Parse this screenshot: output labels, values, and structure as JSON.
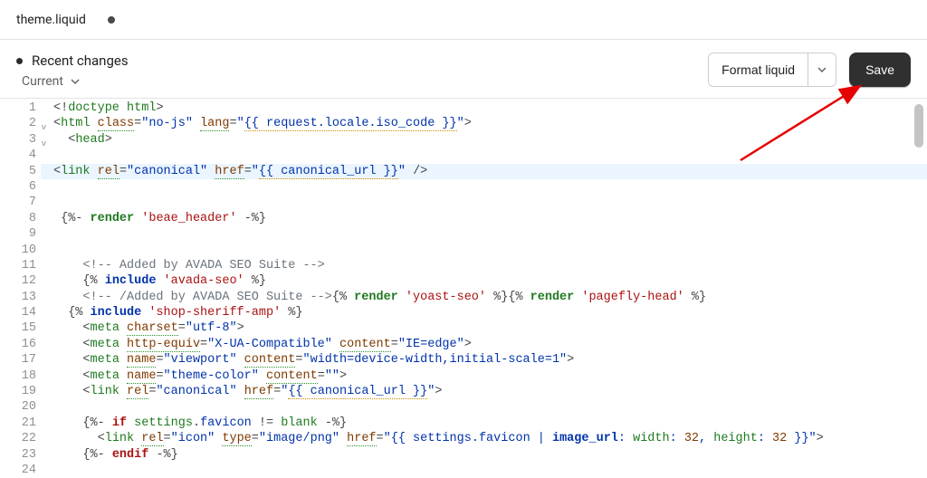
{
  "tab": {
    "filename": "theme.liquid"
  },
  "toolbar": {
    "recent_label": "Recent changes",
    "current_label": "Current",
    "format_label": "Format liquid",
    "save_label": "Save"
  },
  "editor": {
    "highlighted_line": 5,
    "lines": [
      {
        "no": 1,
        "fold": "",
        "html": "<span class='punc'>&lt;!</span><span class='tag'>doctype</span> <span class='tag'>html</span><span class='punc'>&gt;</span>"
      },
      {
        "no": 2,
        "fold": "v",
        "html": "<span class='punc'>&lt;</span><span class='tag'>html</span> <span class='attr underline-green'>class</span><span class='punc'>=</span><span class='str'>\"no-js\"</span> <span class='attr underline-green'>lang</span><span class='punc'>=</span><span class='str'>\"</span><span class='str underline-orange'>{{ request.locale.iso_code }}</span><span class='str'>\"</span><span class='punc'>&gt;</span>"
      },
      {
        "no": 3,
        "fold": "v",
        "html": "  <span class='punc'>&lt;</span><span class='tag'>head</span><span class='punc'>&gt;</span>"
      },
      {
        "no": 4,
        "fold": "",
        "html": ""
      },
      {
        "no": 5,
        "fold": "",
        "html": "<span class='punc'>&lt;</span><span class='tag'>link</span> <span class='attr underline-green'>rel</span><span class='punc'>=</span><span class='str'>\"canonical\"</span> <span class='attr underline-green'>href</span><span class='punc'>=</span><span class='str'>\"</span><span class='str underline-orange'>{{ canonical_url }}</span><span class='str'>\"</span> <span class='punc'>/&gt;</span>"
      },
      {
        "no": 6,
        "fold": "",
        "html": ""
      },
      {
        "no": 7,
        "fold": "",
        "html": ""
      },
      {
        "no": 8,
        "fold": "",
        "html": " <span class='punc'>{%-</span> <span class='liquid-tag'>render</span> <span class='single-str'>'beae_header'</span> <span class='punc'>-%}</span>"
      },
      {
        "no": 9,
        "fold": "",
        "html": ""
      },
      {
        "no": 10,
        "fold": "",
        "html": ""
      },
      {
        "no": 11,
        "fold": "",
        "html": "    <span class='comment'>&lt;!-- Added by AVADA SEO Suite --&gt;</span>"
      },
      {
        "no": 12,
        "fold": "",
        "html": "    <span class='punc'>{%</span> <span class='kw'>include</span> <span class='single-str'>'avada-seo'</span> <span class='punc'>%}</span>"
      },
      {
        "no": 13,
        "fold": "",
        "html": "    <span class='comment'>&lt;!-- /Added by AVADA SEO Suite --&gt;</span><span class='punc'>{%</span> <span class='liquid-tag'>render</span> <span class='single-str'>'yoast-seo'</span> <span class='punc'>%}</span><span class='punc'>{%</span> <span class='liquid-tag'>render</span> <span class='single-str'>'pagefly-head'</span> <span class='punc'>%}</span>"
      },
      {
        "no": 14,
        "fold": "",
        "html": "  <span class='punc'>{%</span> <span class='kw'>include</span> <span class='single-str'>'shop-sheriff-amp'</span> <span class='punc'>%}</span>"
      },
      {
        "no": 15,
        "fold": "",
        "html": "    <span class='punc'>&lt;</span><span class='tag'>meta</span> <span class='attr underline-green'>charset</span><span class='punc'>=</span><span class='str'>\"utf-8\"</span><span class='punc'>&gt;</span>"
      },
      {
        "no": 16,
        "fold": "",
        "html": "    <span class='punc'>&lt;</span><span class='tag'>meta</span> <span class='attr underline-green'>http-equiv</span><span class='punc'>=</span><span class='str'>\"X-UA-Compatible\"</span> <span class='attr underline-green'>content</span><span class='punc'>=</span><span class='str'>\"IE=edge\"</span><span class='punc'>&gt;</span>"
      },
      {
        "no": 17,
        "fold": "",
        "html": "    <span class='punc'>&lt;</span><span class='tag'>meta</span> <span class='attr underline-green'>name</span><span class='punc'>=</span><span class='str'>\"viewport\"</span> <span class='attr underline-green'>content</span><span class='punc'>=</span><span class='str'>\"width=device-width,initial-scale=1\"</span><span class='punc'>&gt;</span>"
      },
      {
        "no": 18,
        "fold": "",
        "html": "    <span class='punc'>&lt;</span><span class='tag'>meta</span> <span class='attr underline-green'>name</span><span class='punc'>=</span><span class='str'>\"theme-color\"</span> <span class='attr underline-green'>content</span><span class='punc'>=</span><span class='str'>\"\"</span><span class='punc'>&gt;</span>"
      },
      {
        "no": 19,
        "fold": "",
        "html": "    <span class='punc'>&lt;</span><span class='tag'>link</span> <span class='attr underline-green'>rel</span><span class='punc'>=</span><span class='str'>\"canonical\"</span> <span class='attr underline-green'>href</span><span class='punc'>=</span><span class='str'>\"</span><span class='str underline-orange'>{{ canonical_url }}</span><span class='str'>\"</span><span class='punc'>&gt;</span>"
      },
      {
        "no": 20,
        "fold": "",
        "html": ""
      },
      {
        "no": 21,
        "fold": "",
        "html": "    <span class='punc'>{%-</span> <span class='kw-red'>if</span> <span class='liquid-var'>settings</span><span class='grey'>.</span><span class='prop'>favicon</span> <span class='grey'>!=</span> <span class='liquid-var'>blank</span> <span class='punc'>-%}</span>"
      },
      {
        "no": 22,
        "fold": "",
        "html": "      <span class='punc'>&lt;</span><span class='tag'>link</span> <span class='attr underline-green'>rel</span><span class='punc'>=</span><span class='str'>\"icon\"</span> <span class='attr underline-green'>type</span><span class='punc'>=</span><span class='str'>\"image/png\"</span> <span class='attr underline-green'>href</span><span class='punc'>=</span><span class='str'>\"{{ settings.favicon | </span><span class='kw'>image_url</span><span class='str'>: </span><span class='liquid-var'>width</span><span class='str'>: </span><span class='num-brown'>32</span><span class='str'>, </span><span class='liquid-var'>height</span><span class='str'>: </span><span class='num-brown'>32</span><span class='str'> }}\"</span><span class='punc'>&gt;</span>"
      },
      {
        "no": 23,
        "fold": "",
        "html": "    <span class='punc'>{%-</span> <span class='kw-red'>endif</span> <span class='punc'>-%}</span>"
      },
      {
        "no": 24,
        "fold": "",
        "html": ""
      }
    ]
  }
}
